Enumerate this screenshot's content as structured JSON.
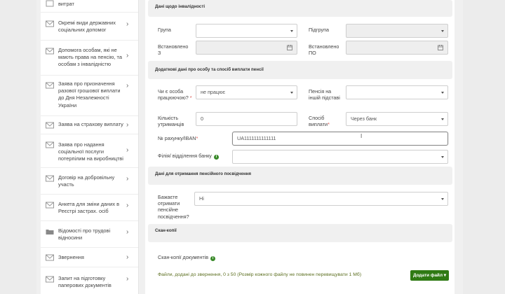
{
  "sidebar": {
    "items": [
      {
        "label": "витрат",
        "icon": "document-icon"
      },
      {
        "label": "Окремі види державних соціальних допомог",
        "icon": "envelope-icon"
      },
      {
        "label": "Допомога особам, які не мають права на пенсію, та особам з інвалідністю",
        "icon": "envelope-icon"
      },
      {
        "label": "Заява про призначення разової грошової виплати до Дня Незалежності України",
        "icon": "envelope-icon"
      },
      {
        "label": "Заява на страхову виплату",
        "icon": "envelope-icon"
      },
      {
        "label": "Заява про надання соціальної послуги потерпілим на виробництві",
        "icon": "envelope-icon"
      },
      {
        "label": "Договір на добровільну участь",
        "icon": "envelope-icon"
      },
      {
        "label": "Анкета для зміни даних в Реєстрі застрах. осіб",
        "icon": "envelope-icon"
      },
      {
        "label": "Відомості про трудові відносини",
        "icon": "folder-icon"
      },
      {
        "label": "Звернення",
        "icon": "envelope-icon"
      },
      {
        "label": "Запит на підготовку паперових документів",
        "icon": "envelope-icon"
      }
    ]
  },
  "sections": {
    "disability": "Дані щодо інвалідності",
    "additional": "Додаткові дані про особу та спосіб виплати пенсії",
    "certificate": "Дані для отримання пенсійного посвідчення",
    "scans": "Скан-копії"
  },
  "disability": {
    "group_label": "Група",
    "group_value": "",
    "subgroup_label": "Підгрупа",
    "subgroup_value": "",
    "set_from_label": "Встановлено З",
    "set_from_value": "",
    "set_to_label": "Встановлено ПО",
    "set_to_value": ""
  },
  "additional": {
    "working_label": "Чи є особа працюючою?",
    "working_value": "не працює",
    "other_pension_label": "Пенсія на іншій підставі",
    "other_pension_value": "",
    "dependents_label": "Кількість утриманців",
    "dependents_value": "0",
    "payment_method_label": "Спосіб виплати",
    "payment_method_value": "Через банк",
    "iban_label": "№ рахунку/IBAN",
    "iban_value": "UA1111111111111",
    "branch_label": "Філія/ відділення банку",
    "branch_value": ""
  },
  "certificate": {
    "wish_label": "Бажаєте отримати пенсійне посвідчення?",
    "wish_value": "Ні"
  },
  "scans": {
    "docs_label": "Скан-копії документів",
    "files_info": "Файли, додані до звернення, 0 з 50 (Розмір кожного файлу не повинен перевищувати 1 Мб)",
    "add_file_button": "Додати файл"
  },
  "colors": {
    "accent_green": "#2f7a13",
    "required_red": "#d9534f",
    "files_text": "#5c6f20"
  }
}
